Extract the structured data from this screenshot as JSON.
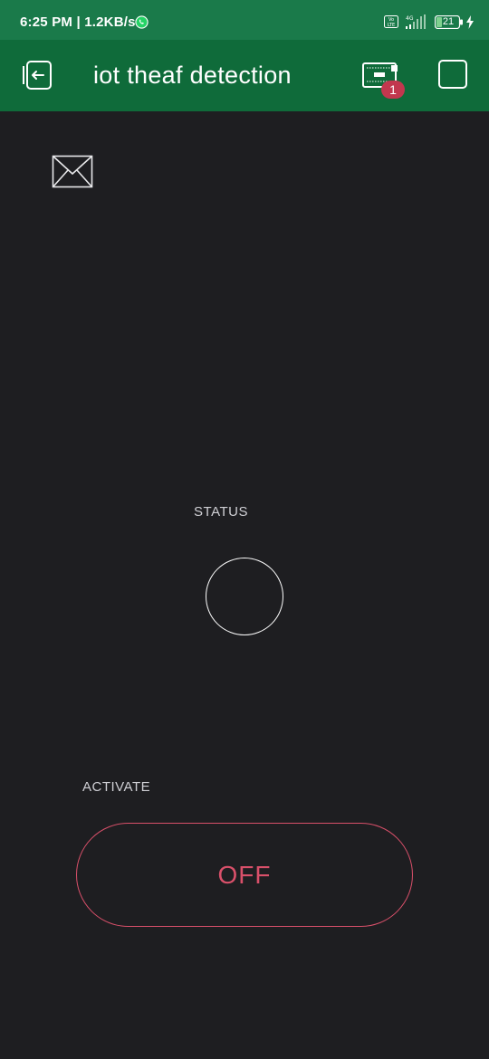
{
  "status_bar": {
    "time_speed": "6:25 PM | 1.2KB/s",
    "battery": "21",
    "network": "4G",
    "icons": [
      "whatsapp-icon",
      "volte-icon",
      "signal-icon",
      "battery-icon",
      "charging-icon"
    ]
  },
  "app_bar": {
    "title": "iot theaf detection",
    "device_badge": "1",
    "icons": [
      "back-icon",
      "device-icon",
      "square-icon"
    ]
  },
  "widgets": {
    "mail_icon": "mail-icon",
    "status_label": "STATUS",
    "activate_label": "ACTIVATE",
    "button_state": "OFF"
  },
  "colors": {
    "statusbar": "#1a7a4a",
    "appbar": "#0f6b3a",
    "background": "#1e1e21",
    "accent": "#d9506a",
    "badge": "#c2374e"
  }
}
